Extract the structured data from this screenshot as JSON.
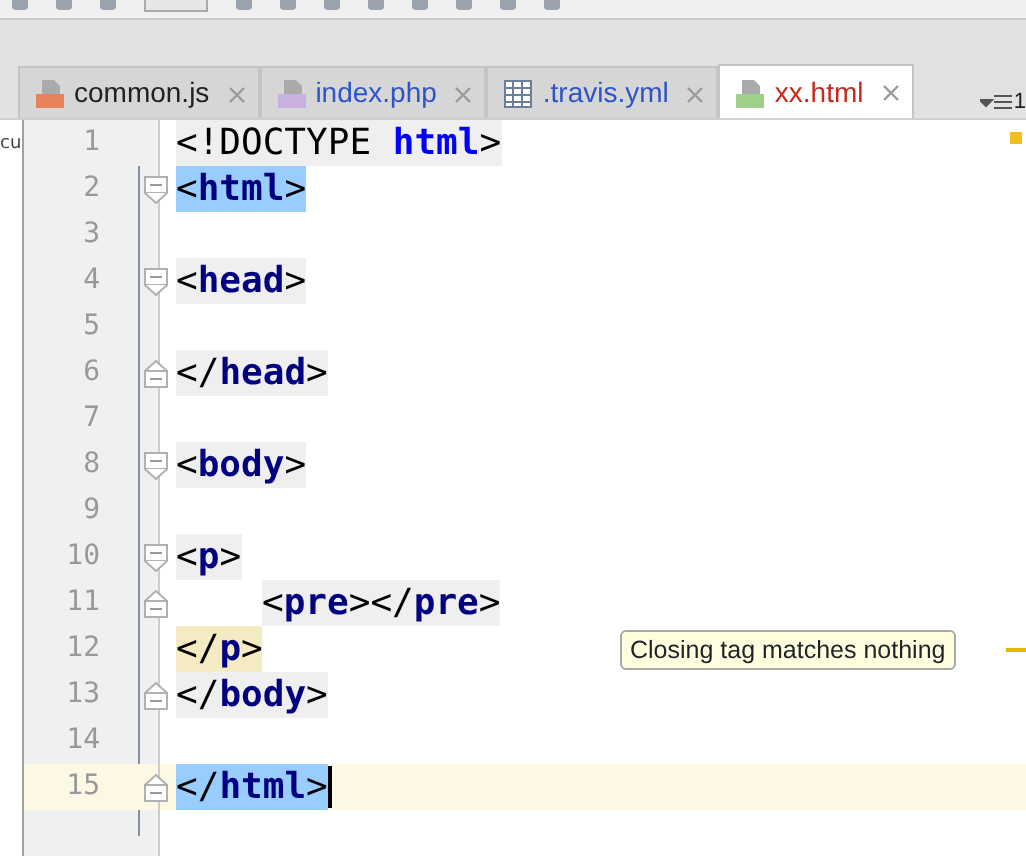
{
  "side_panel": {
    "text": "cu"
  },
  "tabs": [
    {
      "label": "common.js",
      "kind": "js",
      "color": "#222222",
      "selected": false
    },
    {
      "label": "index.php",
      "kind": "php",
      "color": "#2d55c8",
      "selected": false
    },
    {
      "label": ".travis.yml",
      "kind": "table",
      "color": "#2d55c8",
      "selected": false
    },
    {
      "label": "xx.html",
      "kind": "html",
      "color": "#c42b1c",
      "selected": true
    }
  ],
  "tab_overflow_count": "1",
  "lines": [
    {
      "number": "1",
      "fold_open": false,
      "fold_close": false,
      "current": false,
      "tag_match": false,
      "tag_error": false,
      "tokens": [
        {
          "text": "<!DOCTYPE ",
          "kind": "plain"
        },
        {
          "text": "html",
          "kind": "keyword"
        },
        {
          "text": ">",
          "kind": "plain"
        }
      ]
    },
    {
      "number": "2",
      "fold_open": true,
      "fold_close": false,
      "current": false,
      "tag_match": true,
      "tag_error": false,
      "tokens": [
        {
          "text": "<",
          "kind": "plain"
        },
        {
          "text": "html",
          "kind": "tag"
        },
        {
          "text": ">",
          "kind": "plain"
        }
      ]
    },
    {
      "number": "3",
      "fold_open": false,
      "fold_close": false,
      "current": false
    },
    {
      "number": "4",
      "fold_open": true,
      "fold_close": false,
      "current": false,
      "tag_match": false,
      "tag_error": false,
      "tokens": [
        {
          "text": "<",
          "kind": "plain"
        },
        {
          "text": "head",
          "kind": "tag"
        },
        {
          "text": ">",
          "kind": "plain"
        }
      ]
    },
    {
      "number": "5",
      "fold_open": false,
      "fold_close": false,
      "current": false
    },
    {
      "number": "6",
      "fold_open": false,
      "fold_close": true,
      "current": false,
      "tag_match": false,
      "tag_error": false,
      "tokens": [
        {
          "text": "</",
          "kind": "plain"
        },
        {
          "text": "head",
          "kind": "tag"
        },
        {
          "text": ">",
          "kind": "plain"
        }
      ]
    },
    {
      "number": "7",
      "fold_open": false,
      "fold_close": false,
      "current": false
    },
    {
      "number": "8",
      "fold_open": true,
      "fold_close": false,
      "current": false,
      "tag_match": false,
      "tag_error": false,
      "tokens": [
        {
          "text": "<",
          "kind": "plain"
        },
        {
          "text": "body",
          "kind": "tag"
        },
        {
          "text": ">",
          "kind": "plain"
        }
      ]
    },
    {
      "number": "9",
      "fold_open": false,
      "fold_close": false,
      "current": false
    },
    {
      "number": "10",
      "fold_open": true,
      "fold_close": false,
      "current": false,
      "tag_match": false,
      "tag_error": false,
      "tokens": [
        {
          "text": "<",
          "kind": "plain"
        },
        {
          "text": "p",
          "kind": "tag"
        },
        {
          "text": ">",
          "kind": "plain"
        }
      ]
    },
    {
      "number": "11",
      "fold_open": false,
      "fold_close": true,
      "current": false,
      "tag_match": false,
      "tag_error": false,
      "indented": true,
      "tokens": [
        {
          "text": "<",
          "kind": "plain"
        },
        {
          "text": "pre",
          "kind": "tag"
        },
        {
          "text": "></",
          "kind": "plain"
        },
        {
          "text": "pre",
          "kind": "tag"
        },
        {
          "text": ">",
          "kind": "plain"
        }
      ]
    },
    {
      "number": "12",
      "fold_open": false,
      "fold_close": false,
      "current": false,
      "tag_match": false,
      "tag_error": true,
      "tokens": [
        {
          "text": "</",
          "kind": "plain"
        },
        {
          "text": "p",
          "kind": "tag"
        },
        {
          "text": ">",
          "kind": "plain"
        }
      ]
    },
    {
      "number": "13",
      "fold_open": false,
      "fold_close": true,
      "current": false,
      "tag_match": false,
      "tag_error": false,
      "tokens": [
        {
          "text": "</",
          "kind": "plain"
        },
        {
          "text": "body",
          "kind": "tag"
        },
        {
          "text": ">",
          "kind": "plain"
        }
      ]
    },
    {
      "number": "14",
      "fold_open": false,
      "fold_close": false,
      "current": false
    },
    {
      "number": "15",
      "fold_open": false,
      "fold_close": true,
      "current": true,
      "tag_match": true,
      "tag_error": false,
      "tokens": [
        {
          "text": "</",
          "kind": "plain"
        },
        {
          "text": "html",
          "kind": "tag"
        },
        {
          "text": ">",
          "kind": "plain"
        }
      ]
    }
  ],
  "tooltip": {
    "text": "Closing tag matches nothing"
  }
}
